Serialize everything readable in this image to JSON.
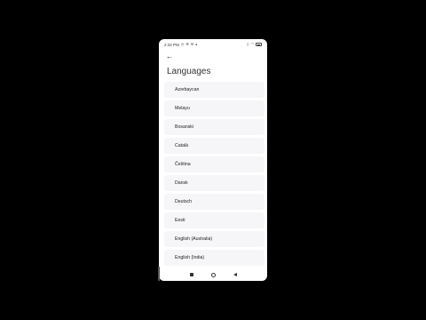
{
  "status_bar": {
    "time": "2:34 PM",
    "left_icons": [
      "alarm-icon",
      "settings-icon",
      "messages-icon",
      "signal-icon"
    ],
    "right_icons": [
      "vibrate-icon",
      "wifi-icon",
      "battery-icon"
    ]
  },
  "header": {
    "back_icon": "arrow-left-icon",
    "title": "Languages"
  },
  "languages": [
    "Azərbaycan",
    "Melayu",
    "Bosanski",
    "Català",
    "Čeština",
    "Dansk",
    "Deutsch",
    "Eesti",
    "English (Australia)",
    "English (India)"
  ],
  "nav_bar": {
    "items": [
      "recents-icon",
      "home-icon",
      "back-icon"
    ]
  },
  "colors": {
    "background": "#000000",
    "screen": "#ffffff",
    "item_background": "#f6f5f8",
    "text": "#222222"
  }
}
